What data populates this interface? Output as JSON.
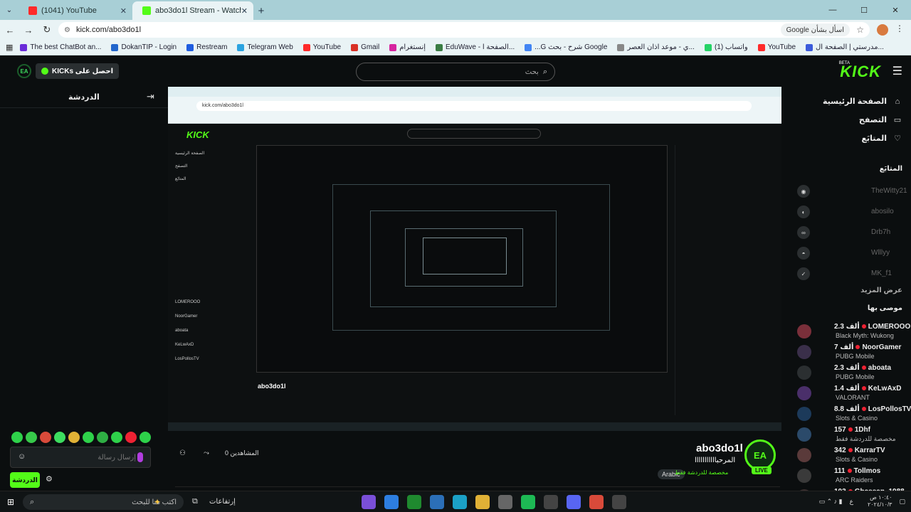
{
  "browser": {
    "tabs": [
      {
        "title": "(1041) YouTube",
        "favicon_color": "#ff2a2a",
        "active": false
      },
      {
        "title": "abo3do1l Stream - Watch Live",
        "favicon_color": "#53fc18",
        "active": true
      }
    ],
    "url": "kick.com/abo3do1l",
    "search_pill": "Google اسأل بشأن",
    "bookmarks": [
      {
        "label": "The best ChatBot an...",
        "color": "#6a2bd9"
      },
      {
        "label": "DokanTIP - Login",
        "color": "#2266cc"
      },
      {
        "label": "Restream",
        "color": "#1f5de0"
      },
      {
        "label": "Telegram Web",
        "color": "#2aa3e0"
      },
      {
        "label": "YouTube",
        "color": "#ff2a2a"
      },
      {
        "label": "Gmail",
        "color": "#d93025"
      },
      {
        "label": "إنستغرام",
        "color": "#d6249f"
      },
      {
        "label": "EduWave - الصفحة ا...",
        "color": "#3a7d44"
      },
      {
        "label": "...G شرح - بحث Google",
        "color": "#4285f4"
      },
      {
        "label": "ي - موعد اذان العصر...",
        "color": "#888888"
      },
      {
        "label": "واتساب (1)",
        "color": "#25d366"
      },
      {
        "label": "YouTube",
        "color": "#ff2a2a"
      },
      {
        "label": "مدرستي | الصفحة ال...",
        "color": "#3b5bdb"
      }
    ]
  },
  "kick": {
    "logo": "KICK",
    "beta": "BETA",
    "search_placeholder": "بحث",
    "get_kicks": "KICKs احصل على",
    "ea_badge": "EA",
    "chat_title": "الدردشة",
    "nav": [
      {
        "label": "الصفحة الرئيسية",
        "icon": "home-icon",
        "glyph": "⌂"
      },
      {
        "label": "التصفح",
        "icon": "browse-icon",
        "glyph": "▭"
      },
      {
        "label": "المتابَع",
        "icon": "heart-icon",
        "glyph": "♡"
      }
    ],
    "following_label": "المتابَع",
    "following": [
      {
        "name": "TheWitty21",
        "glyph": "◉"
      },
      {
        "name": "abosilo",
        "glyph": "◐"
      },
      {
        "name": "Drb7h",
        "glyph": "∞"
      },
      {
        "name": "Wlllyy",
        "glyph": "◓"
      },
      {
        "name": "MK_f1",
        "glyph": "✓"
      }
    ],
    "show_more": "عرض المزيد",
    "recommended_label": "موصى بها",
    "recommended": [
      {
        "name": "LOMEROOO",
        "viewers": "2.3 ألف",
        "game": "Black Myth: Wukong"
      },
      {
        "name": "NoorGamer",
        "viewers": "7 ألف",
        "game": "PUBG Mobile"
      },
      {
        "name": "aboata",
        "viewers": "2.3 ألف",
        "game": "PUBG Mobile"
      },
      {
        "name": "KeLwAxD",
        "viewers": "1.4 ألف",
        "game": "VALORANT"
      },
      {
        "name": "LosPollosTV",
        "viewers": "8.8 ألف",
        "game": "Slots & Casino"
      },
      {
        "name": "1Dhf",
        "viewers": "157",
        "game": "مخصصة للدردشة فقط"
      },
      {
        "name": "KarrarTV",
        "viewers": "342",
        "game": "Slots & Casino"
      },
      {
        "name": "Tollmos",
        "viewers": "111",
        "game": "ARC Raiders"
      },
      {
        "name": "Ghassan_1988",
        "viewers": "103",
        "game": ""
      }
    ],
    "channel": {
      "name": "abo3do1l",
      "title": "المرحبااااااااااا",
      "category": "مخصصة للدردشة فقط",
      "language": "Arabic",
      "live": "LIVE",
      "viewers": "0 المشاهدين"
    },
    "chat_input_placeholder": "إرسال رسالة",
    "send_label": "الدردشة"
  },
  "stream_preview": {
    "url": "kick.com/abo3do1l",
    "channel": "abo3do1l"
  },
  "taskbar": {
    "search_placeholder": "اكتب هنا للبحث",
    "widgets_label": "إرتفاعات",
    "clock_time": "١٠:٤٠ ص",
    "clock_date": "٢٠٢٤/١٠/٣",
    "lang": "ع",
    "apps": [
      {
        "name": "copilot-app",
        "color": "#7a4fd8"
      },
      {
        "name": "store-app",
        "color": "#2d7ee0"
      },
      {
        "name": "xbox-app",
        "color": "#1f8a2f"
      },
      {
        "name": "files-app",
        "color": "#2b6fb8"
      },
      {
        "name": "edge-app",
        "color": "#1ba1c7"
      },
      {
        "name": "folder-app",
        "color": "#e0b136"
      },
      {
        "name": "settings-app",
        "color": "#666666"
      },
      {
        "name": "spotify-app",
        "color": "#1db954"
      },
      {
        "name": "m-app",
        "color": "#444444"
      },
      {
        "name": "discord-app",
        "color": "#5865f2"
      },
      {
        "name": "chrome-app",
        "color": "#d84a3a"
      },
      {
        "name": "obs-app",
        "color": "#444444"
      }
    ]
  }
}
